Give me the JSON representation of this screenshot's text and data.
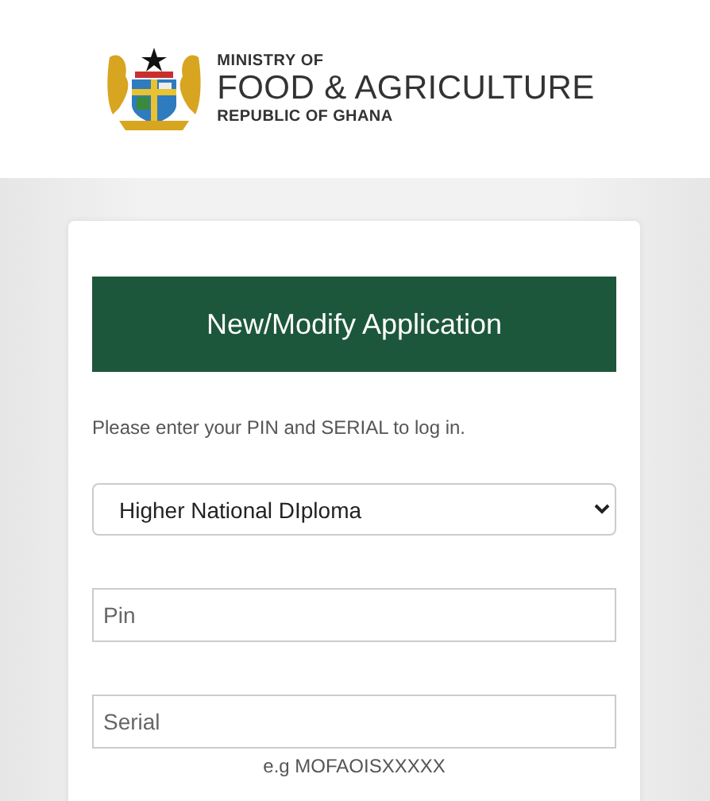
{
  "header": {
    "logo_lines": [
      "MINISTRY OF",
      "FOOD & AGRICULTURE",
      "REPUBLIC OF GHANA"
    ]
  },
  "form": {
    "title": "New/Modify Application",
    "instruction": "Please enter your PIN and SERIAL to log in.",
    "program_select": {
      "value": "Higher National DIploma"
    },
    "pin": {
      "placeholder": "Pin"
    },
    "serial": {
      "placeholder": "Serial",
      "hint": "e.g MOFAOISXXXXX"
    }
  }
}
